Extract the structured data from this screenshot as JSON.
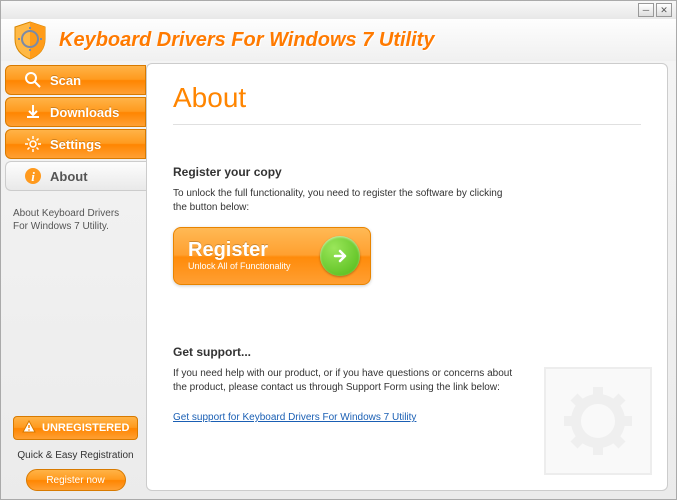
{
  "header": {
    "title": "Keyboard Drivers For Windows 7 Utility"
  },
  "sidebar": {
    "items": [
      {
        "label": "Scan",
        "icon": "search-icon"
      },
      {
        "label": "Downloads",
        "icon": "download-icon"
      },
      {
        "label": "Settings",
        "icon": "gear-icon"
      },
      {
        "label": "About",
        "icon": "info-icon"
      }
    ],
    "description": "About Keyboard Drivers For Windows 7 Utility.",
    "unregistered_label": "UNREGISTERED",
    "quick_reg_text": "Quick & Easy Registration",
    "register_now_label": "Register now"
  },
  "content": {
    "page_title": "About",
    "register_heading": "Register your copy",
    "register_desc": "To unlock the full functionality, you need to register the software by clicking the button below:",
    "register_btn_label": "Register",
    "register_btn_sub": "Unlock All of Functionality",
    "support_heading": "Get support...",
    "support_desc": "If you need help with our product, or if you have questions or concerns about the product, please contact us through Support Form using the link below:",
    "support_link": "Get support for Keyboard Drivers For Windows 7 Utility"
  }
}
